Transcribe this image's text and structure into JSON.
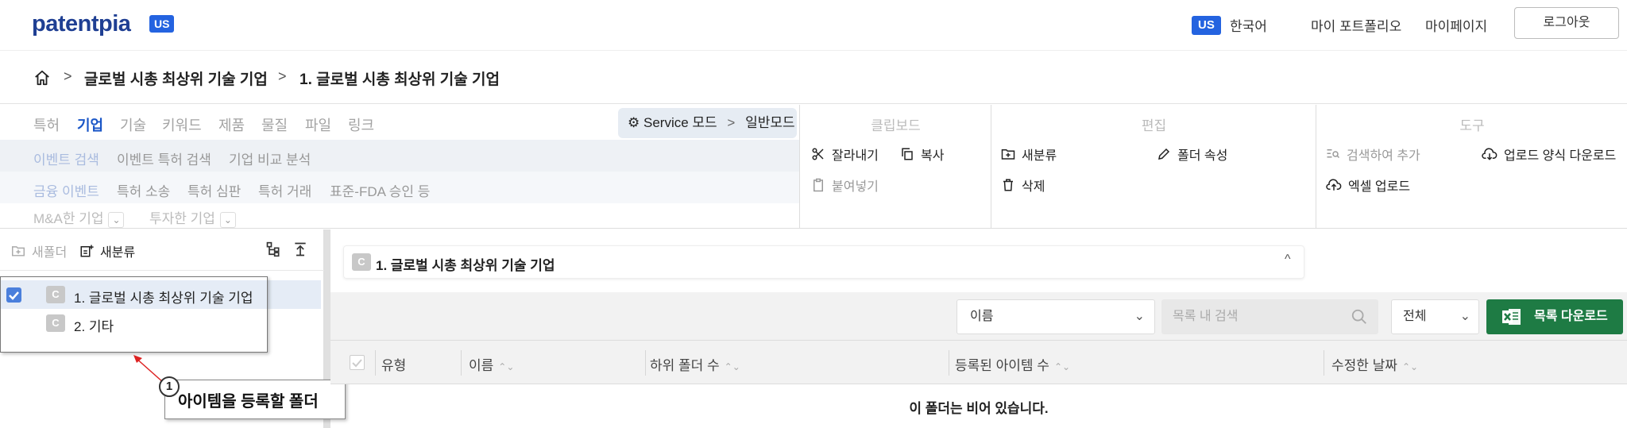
{
  "header": {
    "logo": "patentpia",
    "logo_badge": "US",
    "lang_badge": "US",
    "lang_label": "한국어",
    "my_portfolio": "마이 포트폴리오",
    "my_page": "마이페이지",
    "logout": "로그아웃"
  },
  "breadcrumb": {
    "sep": ">",
    "items": [
      "글로벌 시총 최상위 기술 기업",
      "1. 글로벌 시총 최상위 기술 기업"
    ]
  },
  "ribbon": {
    "tabs": [
      "특허",
      "기업",
      "기술",
      "키워드",
      "제품",
      "물질",
      "파일",
      "링크"
    ],
    "mode": {
      "service": "Service 모드",
      "sep": ">",
      "general": "일반모드"
    },
    "row2": [
      "이벤트 검색",
      "이벤트 특허 검색",
      "기업 비교 분석"
    ],
    "row3": [
      "금융 이벤트",
      "특허 소송",
      "특허 심판",
      "특허 거래",
      "표준-FDA 승인 등"
    ],
    "row4": [
      "M&A한 기업",
      "투자한 기업"
    ],
    "clipboard": {
      "title": "클립보드",
      "cut": "잘라내기",
      "copy": "복사",
      "paste": "붙여넣기"
    },
    "edit": {
      "title": "편집",
      "reclassify": "새분류",
      "folder_props": "폴더 속성",
      "delete": "삭제"
    },
    "tools": {
      "title": "도구",
      "search_add": "검색하여 추가",
      "upload_template": "업로드 양식 다운로드",
      "excel_upload": "엑셀 업로드"
    }
  },
  "left_panel": {
    "new_folder": "새폴더",
    "new_class": "새분류",
    "tree": [
      {
        "badge": "C",
        "label": "1. 글로벌 시총 최상위 기술 기업",
        "checked": true
      },
      {
        "badge": "C",
        "label": "2. 기타",
        "checked": false
      }
    ]
  },
  "callout": {
    "number": "1",
    "text": "아이템을 등록할 폴더"
  },
  "main": {
    "folder_badge": "C",
    "folder_title": "1. 글로벌 시총 최상위 기술 기업",
    "folder_chev": "^",
    "sort_value": "이름",
    "search_placeholder": "목록 내 검색",
    "scope_value": "전체",
    "download_label": "목록 다운로드",
    "columns": [
      "유형",
      "이름",
      "하위 폴더 수",
      "등록된 아이템 수",
      "수정한 날짜"
    ],
    "sort_arrows": "⌃⌄",
    "empty_message": "이 폴더는 비어 있습니다."
  },
  "colors": {
    "brand": "#1f3f93",
    "accent": "#2463e0",
    "download": "#1e7b44"
  }
}
